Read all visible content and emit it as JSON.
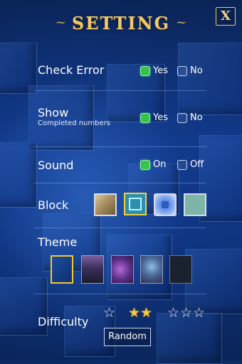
{
  "header": {
    "title": "SETTING",
    "close_label": "X"
  },
  "settings": {
    "check_error": {
      "label": "Check Error",
      "yes": "Yes",
      "no": "No",
      "value": "Yes"
    },
    "show": {
      "label": "Show",
      "sublabel": "Completed numbers",
      "yes": "Yes",
      "no": "No",
      "value": "Yes"
    },
    "sound": {
      "label": "Sound",
      "on": "On",
      "off": "Off",
      "value": "On"
    },
    "block": {
      "label": "Block",
      "options": [
        "wood",
        "teal-frame",
        "blue-glass",
        "sage"
      ],
      "selected": "teal-frame"
    },
    "theme": {
      "label": "Theme",
      "options": [
        "blue-cubes",
        "castle",
        "purple-nebula",
        "cloudy-sky",
        "dark"
      ],
      "selected": "blue-cubes"
    },
    "difficulty": {
      "label": "Difficulty",
      "levels": [
        1,
        2,
        3
      ],
      "selected": 2,
      "random_label": "Random"
    }
  },
  "colors": {
    "accent": "#f0c86a",
    "checked": "#37c24a",
    "selected_border": "#f0cb30",
    "star": "#f5c842"
  }
}
